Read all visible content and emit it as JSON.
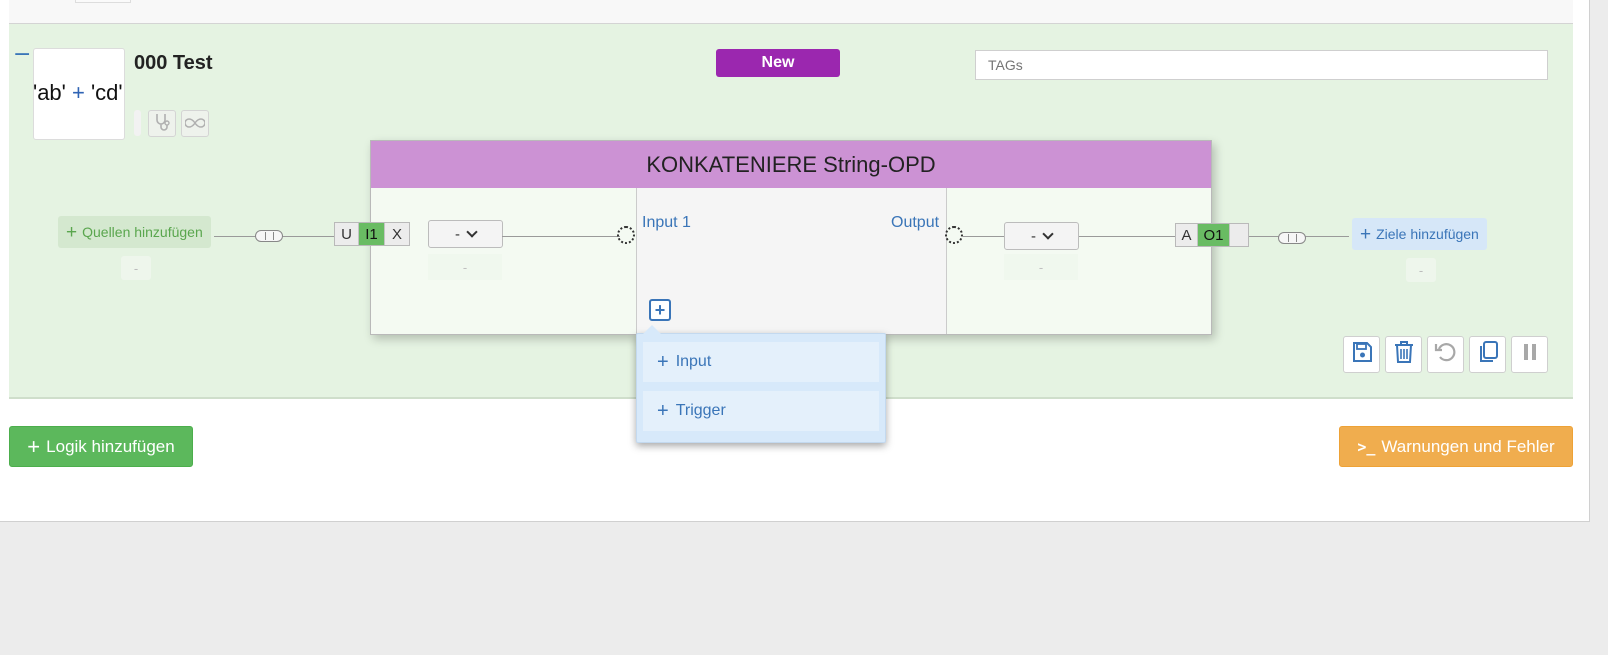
{
  "logic": {
    "collapse_symbol": "−",
    "title": "000 Test",
    "expression": {
      "left": "'ab'",
      "op": "+",
      "right": "'cd'"
    },
    "status_badge": "New",
    "tags_placeholder": "TAGs"
  },
  "block": {
    "title": "KONKATENIERE String-OPD",
    "input_label": "Input 1",
    "output_label": "Output",
    "input_type_segments": [
      "U",
      "I1",
      "X"
    ],
    "output_type_segments": [
      "A",
      "O1",
      ""
    ],
    "input_dropdown_value": "-",
    "output_dropdown_value": "-",
    "input_dropdown_sub": "-",
    "output_dropdown_sub": "-"
  },
  "sources": {
    "add_label": "Quellen hinzufügen",
    "sub": "-"
  },
  "targets": {
    "add_label": "Ziele hinzufügen",
    "sub": "-"
  },
  "add_port_menu": {
    "items": [
      "Input",
      "Trigger"
    ]
  },
  "actions": [
    "save-icon",
    "trash-icon",
    "undo-icon",
    "copy-icon",
    "pause-icon"
  ],
  "footer": {
    "add_logic_label": "Logik hinzufügen",
    "warnings_label": "Warnungen und Fehler"
  },
  "colors": {
    "block_bg": "#e5f3e2",
    "header_purple": "#cc92d4",
    "badge_purple": "#9b27af",
    "success_green": "#5cb85c",
    "warning_orange": "#f0ad4e",
    "link_blue": "#3a75b8"
  }
}
